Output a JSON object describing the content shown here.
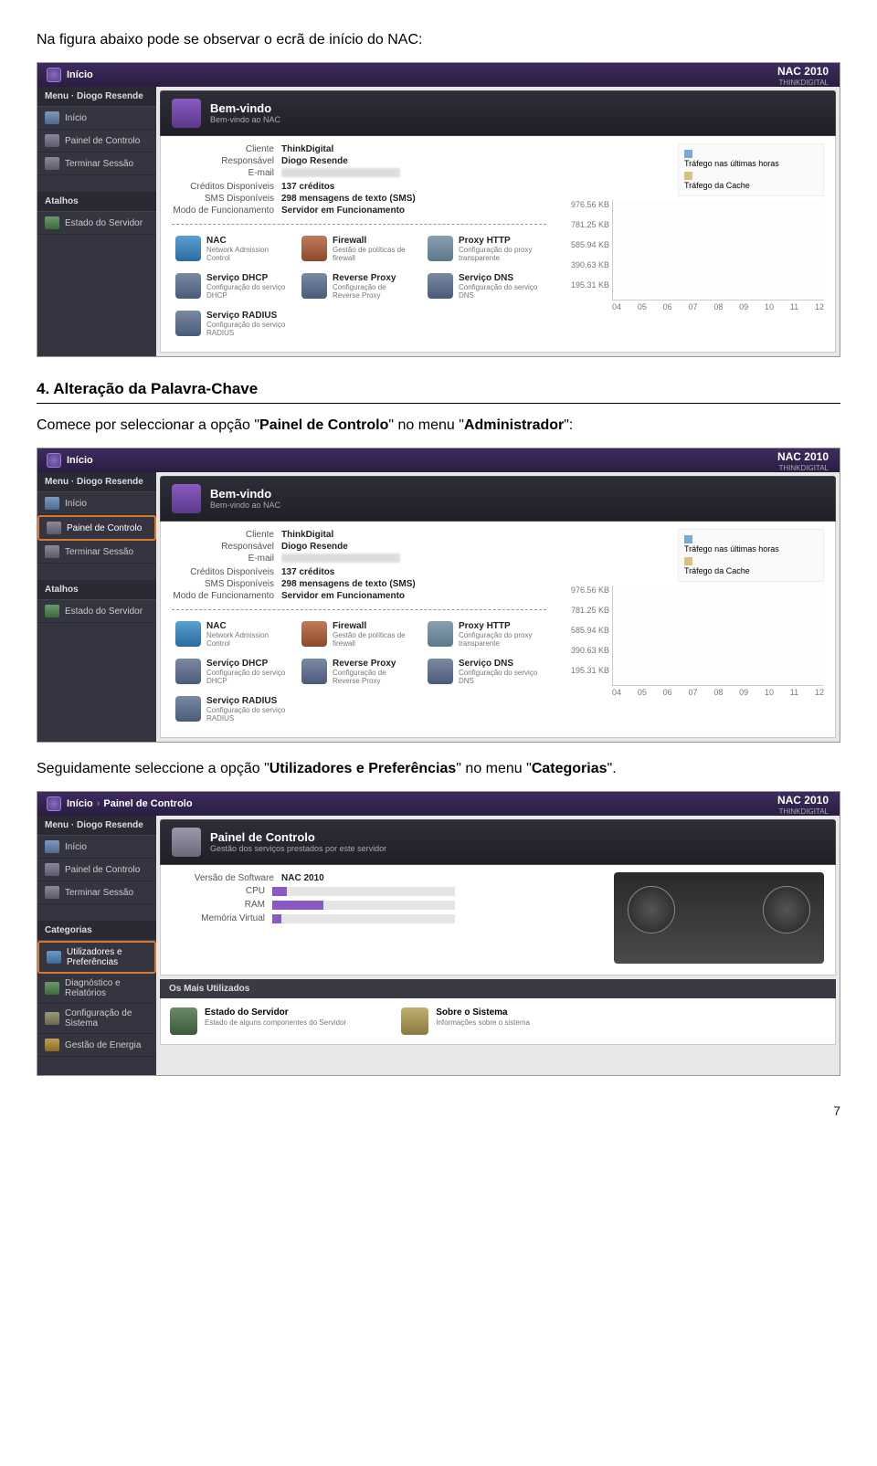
{
  "text": {
    "intro": "Na figura abaixo pode se observar o ecrã de início do NAC:",
    "heading": "4. Alteração da Palavra-Chave",
    "para1_a": "Comece por seleccionar a opção \"",
    "para1_b": "Painel de Controlo",
    "para1_c": "\" no menu \"",
    "para1_d": "Administrador",
    "para1_e": "\":",
    "para2_a": "Seguidamente seleccione a opção \"",
    "para2_b": "Utilizadores e Preferências",
    "para2_c": "\" no menu \"",
    "para2_d": "Categorias",
    "para2_e": "\".",
    "pagenum": "7"
  },
  "brand": {
    "title": "NAC 2010",
    "sub": "THINKDIGITAL"
  },
  "topnav": {
    "inicio": "Início",
    "painel": "Painel de Controlo"
  },
  "sidebar": {
    "menuTitle": "Menu · Diogo Resende",
    "items": [
      "Início",
      "Painel de Controlo",
      "Terminar Sessão"
    ],
    "atalhos": "Atalhos",
    "atalhosItems": [
      "Estado do Servidor"
    ],
    "categorias": "Categorias",
    "catItems": [
      "Utilizadores e Preferências",
      "Diagnóstico e Relatórios",
      "Configuração de Sistema",
      "Gestão de Energia"
    ]
  },
  "welcome": {
    "title": "Bem-vindo",
    "sub": "Bem-vindo ao NAC"
  },
  "info": {
    "rows": [
      {
        "lab": "Cliente",
        "val": "ThinkDigital"
      },
      {
        "lab": "Responsável",
        "val": "Diogo Resende"
      },
      {
        "lab": "E-mail",
        "val": ""
      },
      {
        "lab": "Créditos Disponíveis",
        "val": "137 créditos"
      },
      {
        "lab": "SMS Disponíveis",
        "val": "298 mensagens de texto (SMS)"
      },
      {
        "lab": "Modo de Funcionamento",
        "val": "Servidor em Funcionamento"
      }
    ]
  },
  "shortcuts": [
    {
      "title": "NAC",
      "sub": "Network Admission Control",
      "color": "linear-gradient(#5aa0d0,#2a6aa0)"
    },
    {
      "title": "Firewall",
      "sub": "Gestão de políticas de firewall",
      "color": "linear-gradient(#c07a5a,#8a4a2a)"
    },
    {
      "title": "Proxy HTTP",
      "sub": "Configuração do proxy transparente",
      "color": "linear-gradient(#8aa0b0,#5a7a8a)"
    },
    {
      "title": "Serviço DHCP",
      "sub": "Configuração do serviço DHCP",
      "color": "linear-gradient(#7a8aa0,#4a5a7a)"
    },
    {
      "title": "Reverse Proxy",
      "sub": "Configuração de Reverse Proxy",
      "color": "linear-gradient(#7a8aa0,#4a5a7a)"
    },
    {
      "title": "Serviço DNS",
      "sub": "Configuração do serviço DNS",
      "color": "linear-gradient(#7a8aa0,#4a5a7a)"
    },
    {
      "title": "Serviço RADIUS",
      "sub": "Configuração do serviço RADIUS",
      "color": "linear-gradient(#7a8aa0,#4a5a7a)"
    }
  ],
  "chart_data": {
    "type": "line",
    "title": "",
    "legend": [
      {
        "name": "Tráfego nas últimas horas",
        "color": "#7aa8d8"
      },
      {
        "name": "Tráfego da Cache",
        "color": "#d8c27a"
      }
    ],
    "yticks": [
      "976.56 KB",
      "781.25 KB",
      "585.94 KB",
      "390.63 KB",
      "195.31 KB"
    ],
    "xticks": [
      "04",
      "05",
      "06",
      "07",
      "08",
      "09",
      "10",
      "11",
      "12"
    ],
    "ylabel": "",
    "xlabel": "",
    "series": [
      {
        "name": "Tráfego nas últimas horas",
        "values": [
          0,
          0,
          0,
          0,
          0,
          0,
          0,
          0,
          0
        ]
      },
      {
        "name": "Tráfego da Cache",
        "values": [
          0,
          0,
          0,
          0,
          0,
          0,
          0,
          0,
          0
        ]
      }
    ]
  },
  "panel3": {
    "title": "Painel de Controlo",
    "sub": "Gestão dos serviços prestados por este servidor",
    "rows": [
      {
        "lab": "Versão de Software",
        "val": "NAC 2010"
      },
      {
        "lab": "CPU",
        "val": ""
      },
      {
        "lab": "RAM",
        "val": ""
      },
      {
        "lab": "Memória Virtual",
        "val": ""
      }
    ],
    "bars": {
      "cpu": 8,
      "ram": 28,
      "swap": 5
    },
    "mostUsedTitle": "Os Mais Utilizados",
    "mu": [
      {
        "title": "Estado do Servidor",
        "sub": "Estado de alguns componentes do Servidor",
        "color": "linear-gradient(#6a8a6a,#3a5a3a)"
      },
      {
        "title": "Sobre o Sistema",
        "sub": "Informações sobre o sistema",
        "color": "linear-gradient(#c0b070,#8a7a40)"
      }
    ]
  }
}
